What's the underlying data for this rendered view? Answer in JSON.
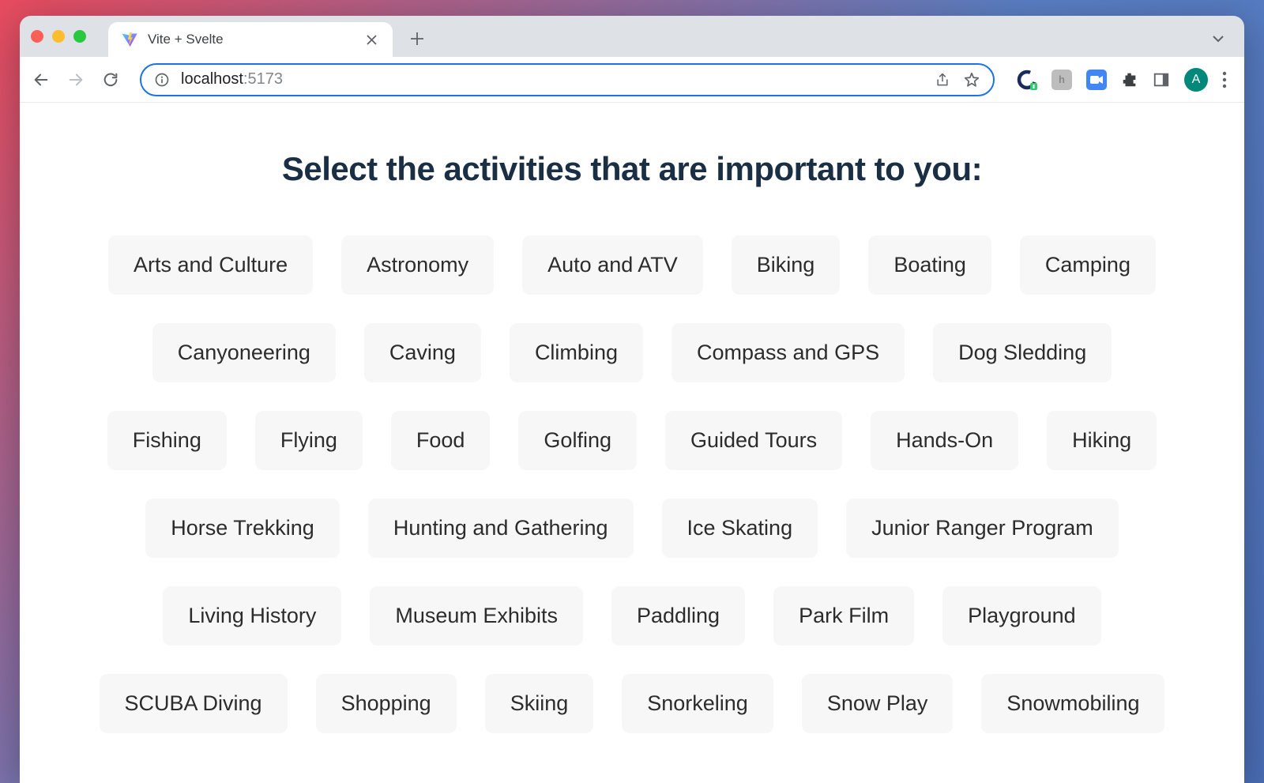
{
  "browser": {
    "tab_title": "Vite + Svelte",
    "url_host": "localhost",
    "url_port": ":5173",
    "avatar_initial": "A"
  },
  "page": {
    "heading": "Select the activities that are important to you:",
    "activities": [
      "Arts and Culture",
      "Astronomy",
      "Auto and ATV",
      "Biking",
      "Boating",
      "Camping",
      "Canyoneering",
      "Caving",
      "Climbing",
      "Compass and GPS",
      "Dog Sledding",
      "Fishing",
      "Flying",
      "Food",
      "Golfing",
      "Guided Tours",
      "Hands-On",
      "Hiking",
      "Horse Trekking",
      "Hunting and Gathering",
      "Ice Skating",
      "Junior Ranger Program",
      "Living History",
      "Museum Exhibits",
      "Paddling",
      "Park Film",
      "Playground",
      "SCUBA Diving",
      "Shopping",
      "Skiing",
      "Snorkeling",
      "Snow Play",
      "Snowmobiling"
    ]
  }
}
